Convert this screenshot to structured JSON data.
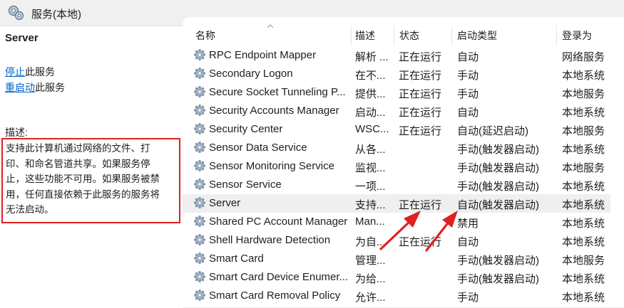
{
  "window": {
    "title": "服务(本地)"
  },
  "left_pane": {
    "service_name": "Server",
    "actions": [
      {
        "link": "停止",
        "suffix": "此服务"
      },
      {
        "link": "重启动",
        "suffix": "此服务"
      }
    ],
    "description_label": "描述:",
    "description_lines": [
      "支持此计算机通过网络的文件、打",
      "印、和命名管道共享。如果服务停",
      "止，这些功能不可用。如果服务被禁",
      "用，任何直接依赖于此服务的服务将",
      "无法启动。"
    ]
  },
  "columns": [
    "名称",
    "描述",
    "状态",
    "启动类型",
    "登录为"
  ],
  "services": [
    {
      "name": "RPC Endpoint Mapper",
      "desc": "解析 ...",
      "status": "正在运行",
      "startup": "自动",
      "logon": "网络服务"
    },
    {
      "name": "Secondary Logon",
      "desc": "在不...",
      "status": "正在运行",
      "startup": "手动",
      "logon": "本地系统"
    },
    {
      "name": "Secure Socket Tunneling P...",
      "desc": "提供...",
      "status": "正在运行",
      "startup": "手动",
      "logon": "本地服务"
    },
    {
      "name": "Security Accounts Manager",
      "desc": "启动...",
      "status": "正在运行",
      "startup": "自动",
      "logon": "本地系统"
    },
    {
      "name": "Security Center",
      "desc": "WSC...",
      "status": "正在运行",
      "startup": "自动(延迟启动)",
      "logon": "本地服务"
    },
    {
      "name": "Sensor Data Service",
      "desc": "从各...",
      "status": "",
      "startup": "手动(触发器启动)",
      "logon": "本地系统"
    },
    {
      "name": "Sensor Monitoring Service",
      "desc": "监视...",
      "status": "",
      "startup": "手动(触发器启动)",
      "logon": "本地服务"
    },
    {
      "name": "Sensor Service",
      "desc": "一项...",
      "status": "",
      "startup": "手动(触发器启动)",
      "logon": "本地系统"
    },
    {
      "name": "Server",
      "desc": "支持...",
      "status": "正在运行",
      "startup": "自动(触发器启动)",
      "logon": "本地系统",
      "selected": true
    },
    {
      "name": "Shared PC Account Manager",
      "desc": "Man...",
      "status": "",
      "startup": "禁用",
      "logon": "本地系统"
    },
    {
      "name": "Shell Hardware Detection",
      "desc": "为自...",
      "status": "正在运行",
      "startup": "自动",
      "logon": "本地系统"
    },
    {
      "name": "Smart Card",
      "desc": "管理...",
      "status": "",
      "startup": "手动(触发器启动)",
      "logon": "本地服务"
    },
    {
      "name": "Smart Card Device Enumer...",
      "desc": "为给...",
      "status": "",
      "startup": "手动(触发器启动)",
      "logon": "本地系统"
    },
    {
      "name": "Smart Card Removal Policy",
      "desc": "允许...",
      "status": "",
      "startup": "手动",
      "logon": "本地系统"
    }
  ],
  "icons": {
    "title": "services-gear-icon",
    "row": "service-gear-icon",
    "annotation": "red-arrow"
  },
  "colors": {
    "link": "#0066cc",
    "highlight_border": "#e02020",
    "arrow": "#e02020",
    "selected_row": "#efefef"
  }
}
